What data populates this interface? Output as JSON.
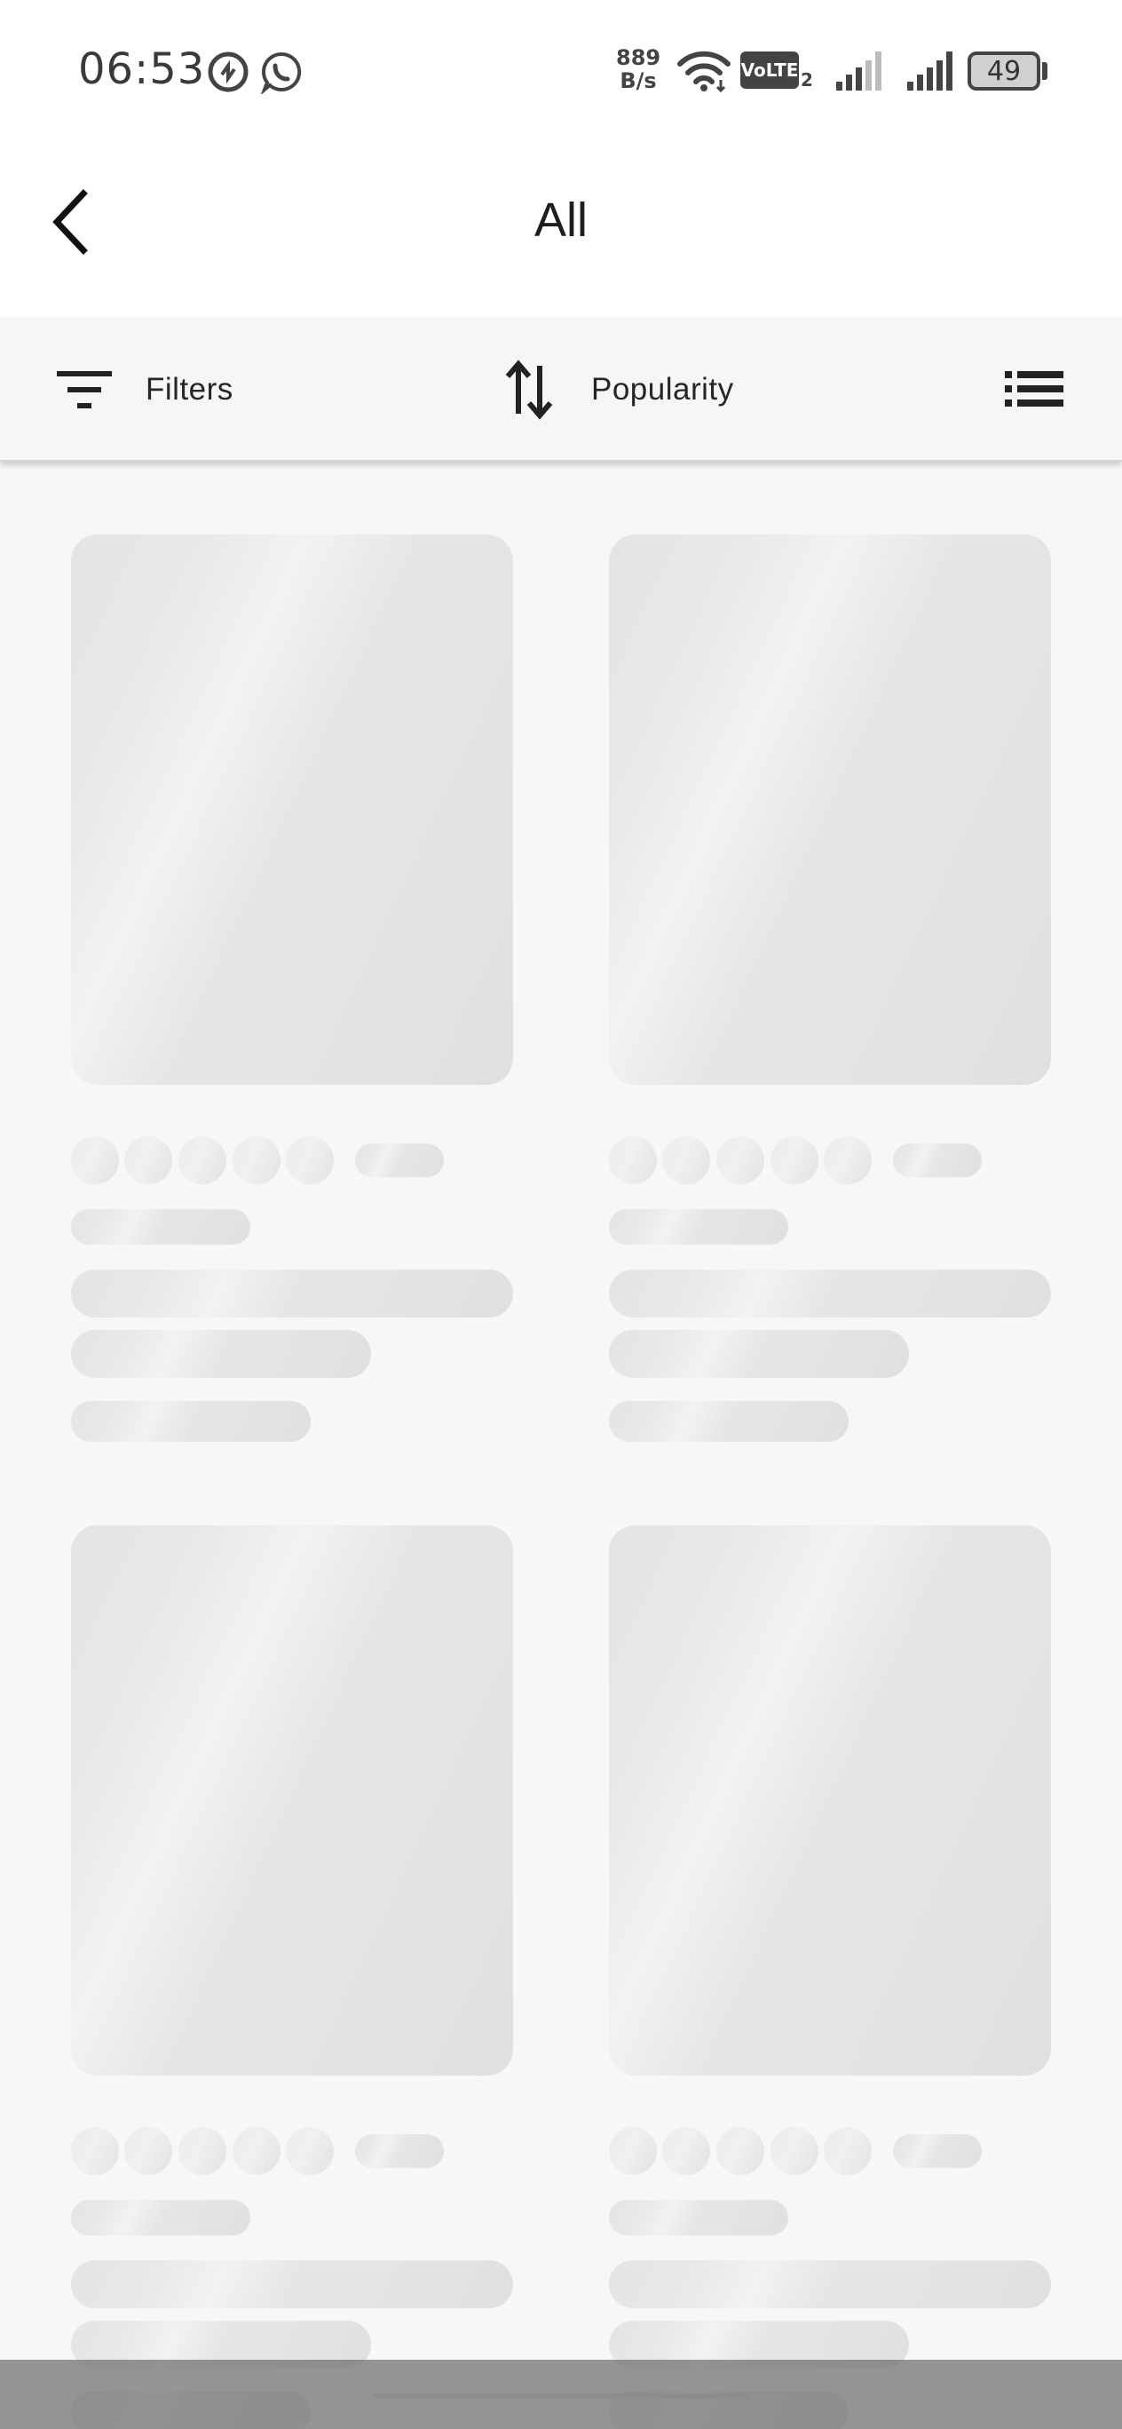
{
  "status_bar": {
    "time": "06:53",
    "net_speed_value": "889",
    "net_speed_unit": "B/s",
    "network_badge": "VoLTE",
    "network_badge_sub": "2",
    "battery": "49"
  },
  "header": {
    "title": "All"
  },
  "toolbar": {
    "filters_label": "Filters",
    "sort_label": "Popularity"
  },
  "products": {
    "state": "loading",
    "placeholder_cards": 4,
    "columns": 2,
    "rating_placeholder_stars": 5
  },
  "colors": {
    "background": "#f7f7f7",
    "skeleton": "#e4e4e4",
    "text": "#222222"
  }
}
